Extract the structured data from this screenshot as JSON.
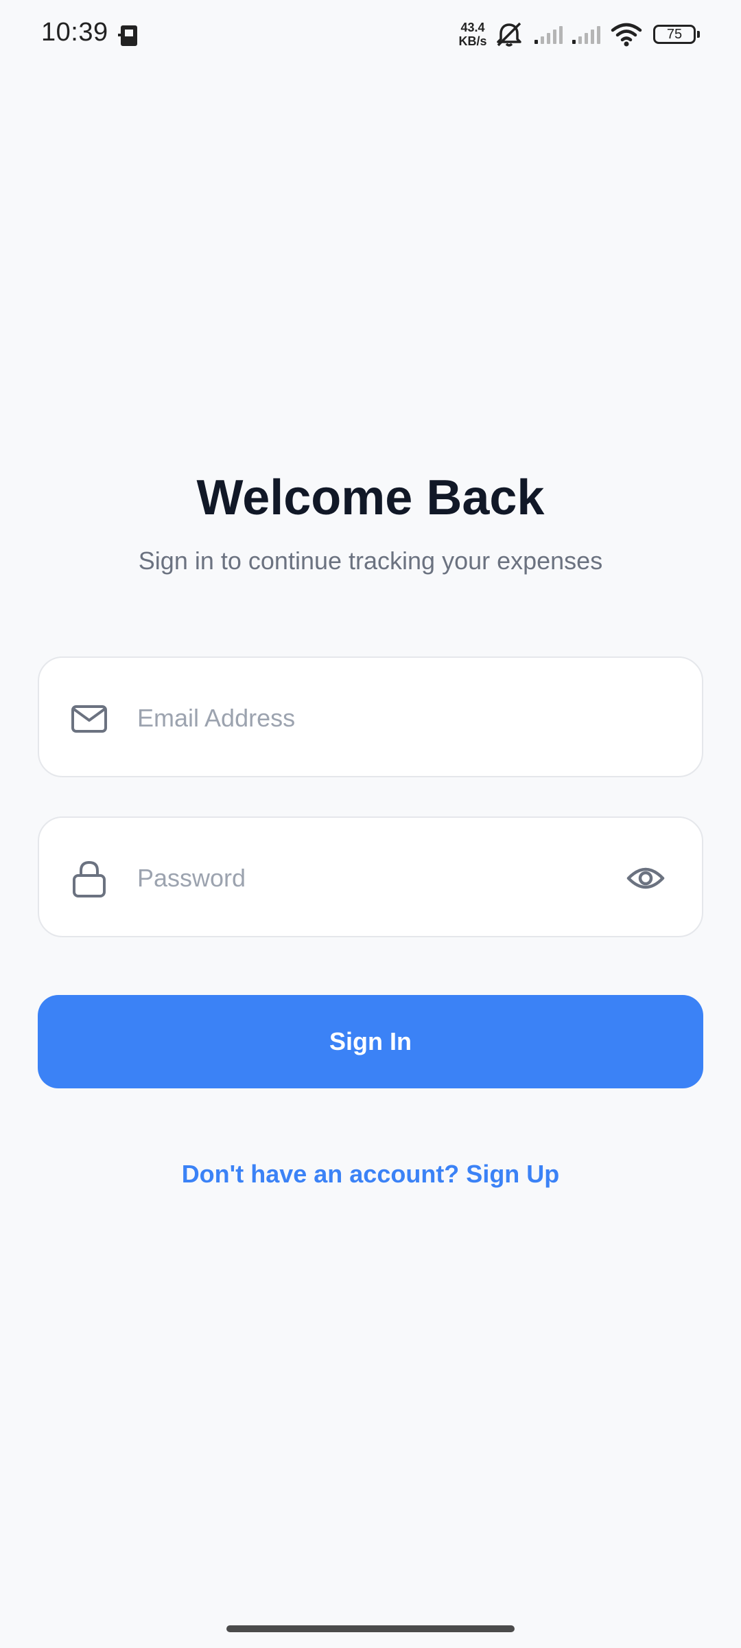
{
  "status_bar": {
    "time": "10:39",
    "net_speed_value": "43.4",
    "net_speed_unit": "KB/s",
    "battery_level": "75",
    "icons": [
      "app-notification-icon",
      "bell-muted-icon",
      "signal-icon",
      "signal-icon",
      "wifi-icon",
      "battery-icon"
    ]
  },
  "header": {
    "title": "Welcome Back",
    "subtitle": "Sign in to continue tracking your expenses"
  },
  "form": {
    "email": {
      "placeholder": "Email Address",
      "value": "",
      "icon": "mail-icon"
    },
    "password": {
      "placeholder": "Password",
      "value": "",
      "icon": "lock-icon",
      "toggle_icon": "eye-icon"
    },
    "submit_label": "Sign In"
  },
  "footer": {
    "signup_text": "Don't have an account? Sign Up"
  },
  "colors": {
    "accent": "#3b82f6",
    "background": "#f8f9fb",
    "title": "#111827",
    "subtitle": "#6b7280",
    "placeholder": "#9ca3af",
    "field_border": "#e5e7eb"
  }
}
